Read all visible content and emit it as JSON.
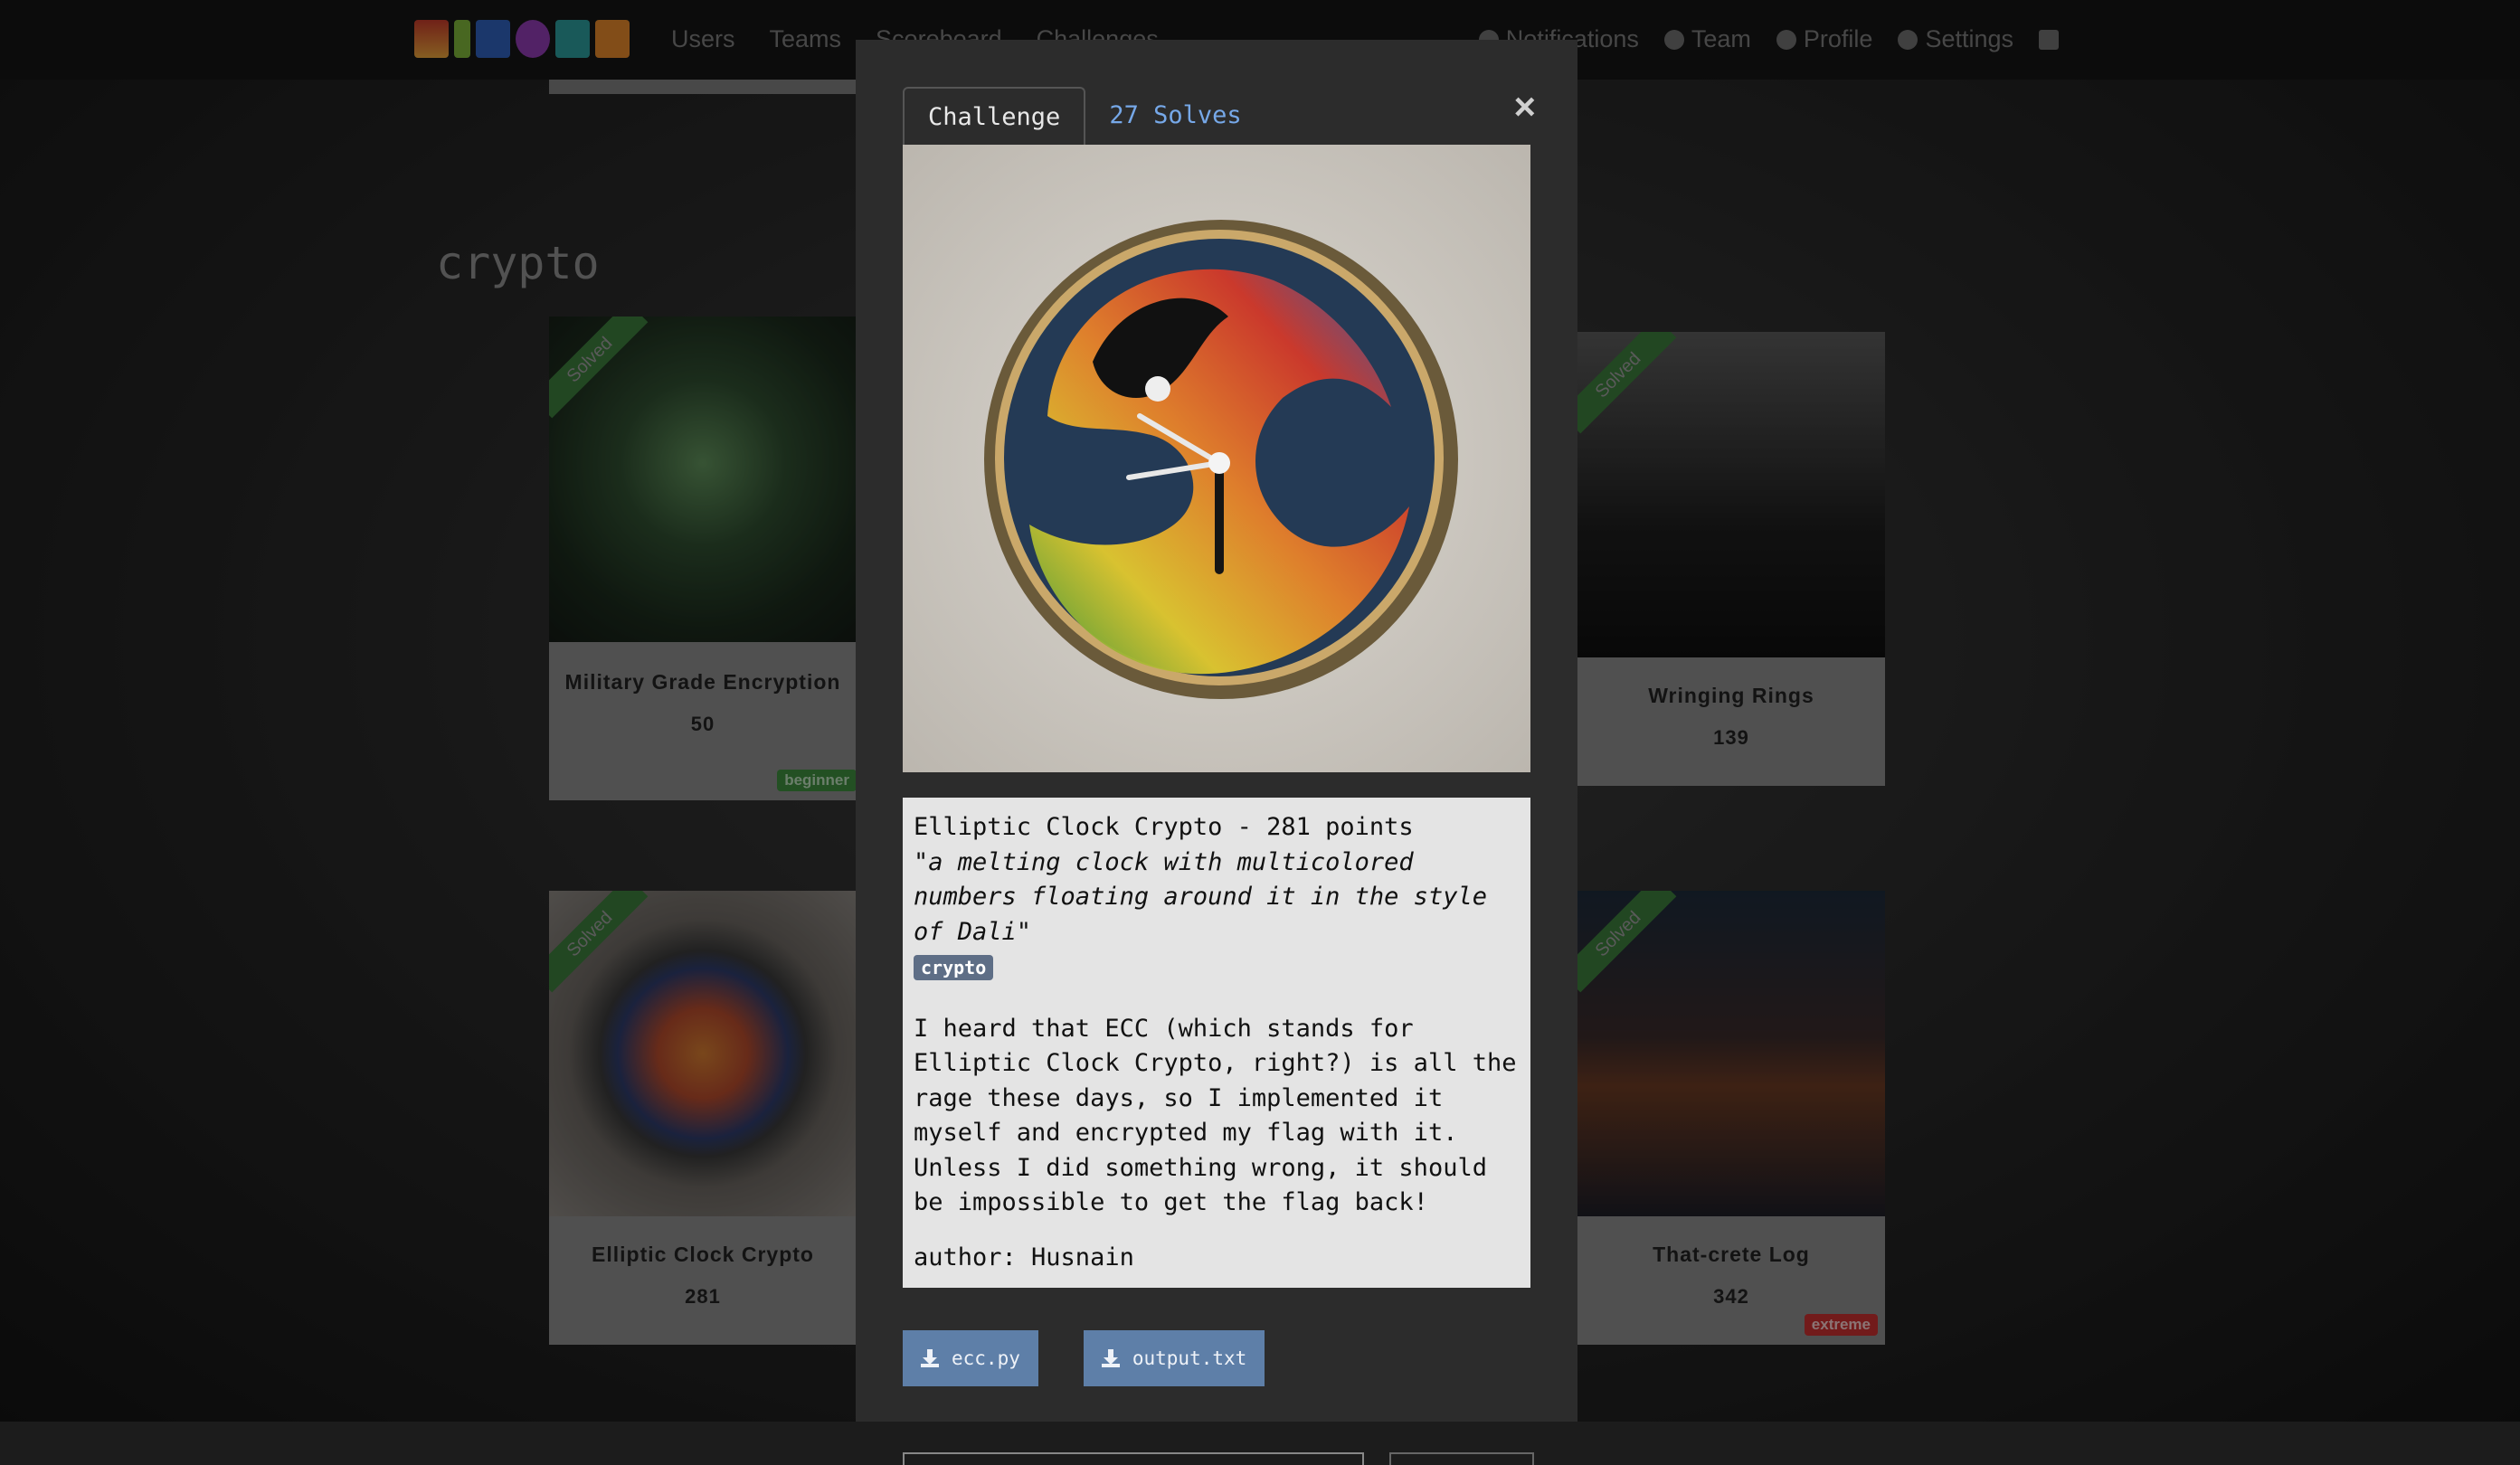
{
  "nav": {
    "links": [
      "Users",
      "Teams",
      "Scoreboard",
      "Challenges"
    ],
    "right": [
      "Notifications",
      "Team",
      "Profile",
      "Settings"
    ],
    "icons": [
      "bell-icon",
      "team-icon",
      "profile-icon",
      "settings-icon",
      "logout-icon"
    ]
  },
  "section": {
    "title": "crypto"
  },
  "cards": [
    {
      "title": "Military Grade Encryption",
      "points": "50",
      "solved": "Solved",
      "badge": "beginner"
    },
    {
      "title": "Wringing Rings",
      "points": "139",
      "solved": "Solved",
      "badge": ""
    },
    {
      "title": "Elliptic Clock Crypto",
      "points": "281",
      "solved": "Solved",
      "badge": ""
    },
    {
      "title": "That-crete Log",
      "points": "342",
      "solved": "Solved",
      "badge": "extreme"
    }
  ],
  "modal": {
    "tab_challenge": "Challenge",
    "tab_solves": "27 Solves",
    "close": "×",
    "heading": "Elliptic Clock Crypto - 281 points",
    "quote": "\"a melting clock with multicolored numbers floating around it in the style of Dali\"",
    "category": "crypto",
    "description": "I heard that ECC (which stands for Elliptic Clock Crypto, right?) is all the rage these days, so I implemented it myself and encrypted my flag with it. Unless I did something wrong, it should be impossible to get the flag back!",
    "author": "author: Husnain",
    "files": [
      "ecc.py",
      "output.txt"
    ]
  },
  "colors": {
    "accent_link": "#76a8e8",
    "file_button": "#5e7fa8",
    "solved_ribbon": "#3c7a3c",
    "badge_beginner": "#3d8a3d",
    "badge_extreme": "#c43030",
    "category_badge": "#5e6e86"
  }
}
